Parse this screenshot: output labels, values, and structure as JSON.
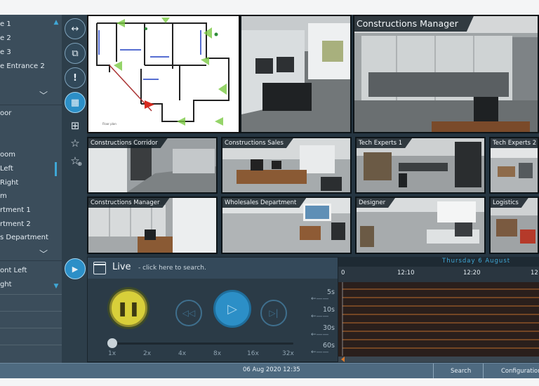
{
  "camera_list": {
    "items_top": [
      "e 1",
      "e 2",
      "e 3",
      "e Entrance 2"
    ],
    "items_middle": [
      "oor",
      "oom",
      "Left",
      "Right",
      "m",
      "rtment 1",
      "rtment 2",
      "s Department"
    ],
    "items_bottom": [
      "ont Left",
      "ght"
    ]
  },
  "tools": {
    "expand_icon": "↔",
    "window_icon": "⧉",
    "alert_icon": "!",
    "layout_icon": "▦",
    "grid_icon": "⊞",
    "star_icon": "☆",
    "star_add_icon": "☆",
    "play_icon": "▶"
  },
  "cameras": {
    "main": {
      "label": "Constructions Manager"
    },
    "tiles": [
      {
        "label": "Constructions Corridor"
      },
      {
        "label": "Constructions Sales"
      },
      {
        "label": "Tech Experts 1"
      },
      {
        "label": "Tech Experts 2"
      },
      {
        "label": "Constructions Manager"
      },
      {
        "label": "Wholesales Department"
      },
      {
        "label": "Designer"
      },
      {
        "label": "Logistics"
      }
    ]
  },
  "playback": {
    "mode": "Live",
    "hint": "- click here to search.",
    "speeds": [
      "1x",
      "2x",
      "4x",
      "8x",
      "16x",
      "32x"
    ],
    "steps": [
      "5s",
      "10s",
      "30s",
      "60s"
    ],
    "speed_position": 0
  },
  "timeline": {
    "date": "Thursday 6 August",
    "ticks": [
      "0",
      "12:10",
      "12:20",
      "12"
    ]
  },
  "status": {
    "datetime": "06 Aug 2020  12:35",
    "tabs": [
      "Search",
      "Configuration"
    ]
  },
  "colors": {
    "accent": "#2c8fc7",
    "pause_button": "#d8cf3a",
    "timeline_line": "#d97a2e"
  }
}
